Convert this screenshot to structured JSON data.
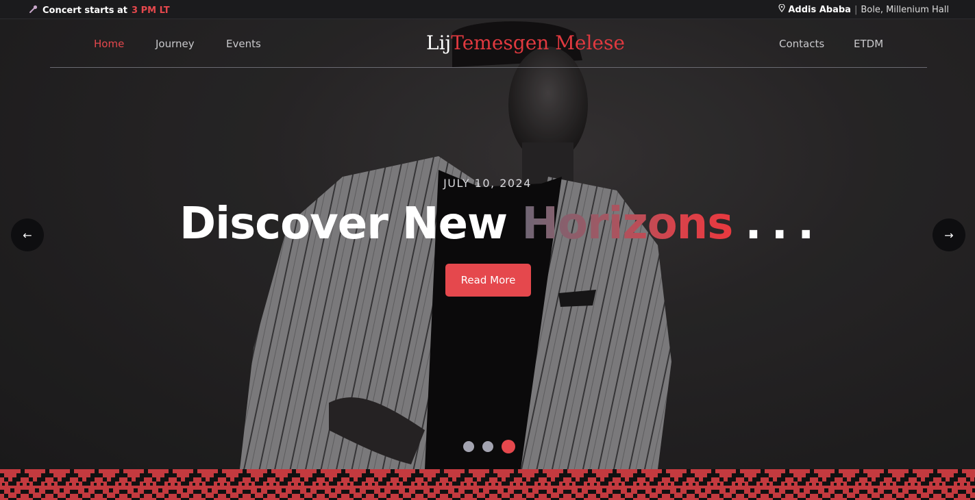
{
  "topbar": {
    "concert_prefix": "Concert starts at",
    "concert_time": "3 PM LT",
    "city": "Addis Ababa",
    "separator": "|",
    "venue": "Bole, Millenium Hall"
  },
  "nav": {
    "left": [
      "Home",
      "Journey",
      "Events"
    ],
    "right": [
      "Contacts",
      "ETDM"
    ],
    "brand_first": "Lij",
    "brand_second": "Temesgen Melese"
  },
  "slide": {
    "date": "JULY 10, 2024",
    "headline_plain": "Discover New",
    "headline_accent": "Horizons",
    "headline_dots": "...",
    "cta": "Read More",
    "prev_arrow": "←",
    "next_arrow": "→",
    "total_slides": 3,
    "active_slide": 3
  },
  "colors": {
    "accent": "#e5484d",
    "band_red": "#c43a3f",
    "band_black": "#111111"
  }
}
